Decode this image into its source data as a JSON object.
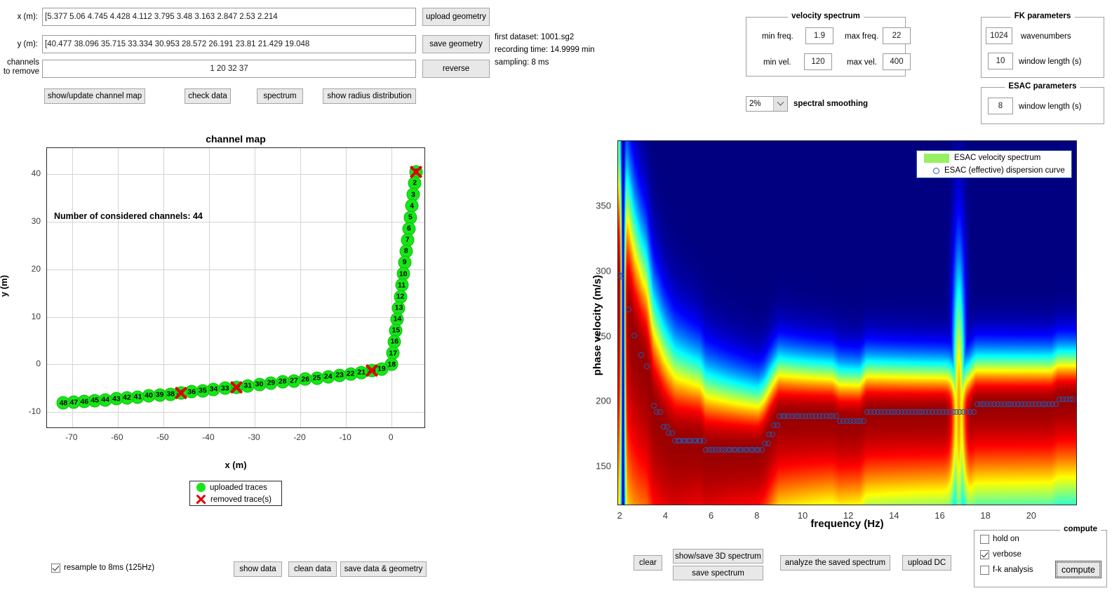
{
  "geometry": {
    "x_label": "x (m):",
    "x_value": "[5.377      5.06      4.745      4.428      4.112      3.795      3.48      3.163      2.847      2.53      2.214",
    "y_label": "y (m):",
    "y_value": "[40.477      38.096      35.715      33.334      30.953      28.572      26.191      23.81      21.429      19.048",
    "channels_label_line1": "channels",
    "channels_label_line2": "to remove",
    "channels_value": "1  20  32  37",
    "upload_geometry": "upload geometry",
    "save_geometry": "save geometry",
    "reverse": "reverse"
  },
  "dataset_info": {
    "first_dataset": "first dataset: 1001.sg2",
    "recording_time": "recording time: 14.9999 min",
    "sampling": "sampling: 8 ms"
  },
  "actions_row": {
    "show_update_channel_map": "show/update channel map",
    "check_data": "check data",
    "spectrum": "spectrum",
    "show_radius_distribution": "show radius distribution"
  },
  "velocity_spectrum": {
    "title": "velocity spectrum",
    "min_freq_label": "min freq.",
    "min_freq_value": "1.9",
    "max_freq_label": "max freq.",
    "max_freq_value": "22",
    "min_vel_label": "min vel.",
    "min_vel_value": "120",
    "max_vel_label": "max vel.",
    "max_vel_value": "400"
  },
  "smoothing": {
    "value": "2%",
    "label": "spectral smoothing",
    "options": [
      "2%"
    ]
  },
  "fk_parameters": {
    "title": "FK parameters",
    "wavenumbers_value": "1024",
    "wavenumbers_label": "wavenumbers",
    "window_length_value": "10",
    "window_length_label": "window length (s)"
  },
  "esac_parameters": {
    "title": "ESAC parameters",
    "window_length_value": "8",
    "window_length_label": "window length (s)"
  },
  "bottom_left": {
    "resample_label": "resample to 8ms (125Hz)",
    "resample_checked": true,
    "show_data": "show data",
    "clean_data": "clean data",
    "save_data_geometry": "save data & geometry"
  },
  "bottom_right": {
    "clear": "clear",
    "show_save_3d_spectrum": "show/save 3D spectrum",
    "save_spectrum": "save spectrum",
    "analyze_saved_spectrum": "analyze the saved spectrum",
    "upload_dc": "upload DC",
    "compute_panel_title": "compute",
    "hold_on_label": "hold on",
    "hold_on_checked": false,
    "verbose_label": "verbose",
    "verbose_checked": true,
    "fk_analysis_label": "f-k analysis",
    "fk_analysis_checked": false,
    "compute_button": "compute"
  },
  "colors": {
    "trace_green": "#16e616",
    "removed_red": "#e00000",
    "dispersion_blue": "#2a56a8",
    "legend_swatch_green": "#96f062",
    "button_face": "#e8e8e8"
  },
  "chart_data": [
    {
      "type": "scatter",
      "id": "channel-map",
      "title": "channel map",
      "xlabel": "x (m)",
      "ylabel": "y (m)",
      "xlim": [
        -75.5,
        7.5
      ],
      "ylim": [
        -13.5,
        45.5
      ],
      "xticks": [
        -70,
        -60,
        -50,
        -40,
        -30,
        -20,
        -10,
        0
      ],
      "yticks": [
        -10,
        0,
        10,
        20,
        30,
        40
      ],
      "grid": true,
      "annotation": "Number of considered channels: 44",
      "legend": [
        "uploaded traces",
        "removed trace(s)"
      ],
      "legend_position": "below-axes-center",
      "removed_channels": [
        1,
        20,
        32,
        37
      ],
      "points": [
        {
          "ch": 1,
          "x": 5.377,
          "y": 40.477
        },
        {
          "ch": 2,
          "x": 5.06,
          "y": 38.096
        },
        {
          "ch": 3,
          "x": 4.745,
          "y": 35.715
        },
        {
          "ch": 4,
          "x": 4.428,
          "y": 33.334
        },
        {
          "ch": 5,
          "x": 4.112,
          "y": 30.953
        },
        {
          "ch": 6,
          "x": 3.795,
          "y": 28.572
        },
        {
          "ch": 7,
          "x": 3.48,
          "y": 26.191
        },
        {
          "ch": 8,
          "x": 3.163,
          "y": 23.81
        },
        {
          "ch": 9,
          "x": 2.847,
          "y": 21.429
        },
        {
          "ch": 10,
          "x": 2.53,
          "y": 19.048
        },
        {
          "ch": 11,
          "x": 2.214,
          "y": 16.667
        },
        {
          "ch": 12,
          "x": 1.897,
          "y": 14.286
        },
        {
          "ch": 13,
          "x": 1.581,
          "y": 11.905
        },
        {
          "ch": 14,
          "x": 1.264,
          "y": 9.524
        },
        {
          "ch": 15,
          "x": 0.948,
          "y": 7.143
        },
        {
          "ch": 16,
          "x": 0.632,
          "y": 4.762
        },
        {
          "ch": 17,
          "x": 0.316,
          "y": 2.381
        },
        {
          "ch": 18,
          "x": 0.0,
          "y": 0.0
        },
        {
          "ch": 19,
          "x": -2.2,
          "y": -0.95
        },
        {
          "ch": 20,
          "x": -4.4,
          "y": -1.3
        },
        {
          "ch": 21,
          "x": -6.6,
          "y": -1.65
        },
        {
          "ch": 22,
          "x": -9.0,
          "y": -2.0
        },
        {
          "ch": 23,
          "x": -11.4,
          "y": -2.3
        },
        {
          "ch": 24,
          "x": -13.9,
          "y": -2.6
        },
        {
          "ch": 25,
          "x": -16.4,
          "y": -2.85
        },
        {
          "ch": 26,
          "x": -18.9,
          "y": -3.1
        },
        {
          "ch": 27,
          "x": -21.4,
          "y": -3.4
        },
        {
          "ch": 28,
          "x": -23.9,
          "y": -3.65
        },
        {
          "ch": 29,
          "x": -26.4,
          "y": -3.9
        },
        {
          "ch": 30,
          "x": -29.0,
          "y": -4.2
        },
        {
          "ch": 31,
          "x": -31.5,
          "y": -4.5
        },
        {
          "ch": 32,
          "x": -34.0,
          "y": -4.75
        },
        {
          "ch": 33,
          "x": -36.5,
          "y": -5.0
        },
        {
          "ch": 34,
          "x": -39.0,
          "y": -5.25
        },
        {
          "ch": 35,
          "x": -41.4,
          "y": -5.5
        },
        {
          "ch": 36,
          "x": -43.8,
          "y": -5.75
        },
        {
          "ch": 37,
          "x": -46.2,
          "y": -6.0
        },
        {
          "ch": 38,
          "x": -48.4,
          "y": -6.2
        },
        {
          "ch": 39,
          "x": -50.8,
          "y": -6.4
        },
        {
          "ch": 40,
          "x": -53.2,
          "y": -6.6
        },
        {
          "ch": 41,
          "x": -55.6,
          "y": -6.8
        },
        {
          "ch": 42,
          "x": -58.0,
          "y": -7.0
        },
        {
          "ch": 43,
          "x": -60.3,
          "y": -7.2
        },
        {
          "ch": 44,
          "x": -62.7,
          "y": -7.4
        },
        {
          "ch": 45,
          "x": -65.0,
          "y": -7.6
        },
        {
          "ch": 46,
          "x": -67.3,
          "y": -7.8
        },
        {
          "ch": 47,
          "x": -69.6,
          "y": -7.95
        },
        {
          "ch": 48,
          "x": -71.9,
          "y": -8.1
        }
      ]
    },
    {
      "type": "heatmap",
      "id": "velocity-spectrum",
      "title": "",
      "xlabel": "frequency (Hz)",
      "ylabel": "phase velocity (m/s)",
      "xlim": [
        1.9,
        22
      ],
      "ylim": [
        120,
        400
      ],
      "xticks": [
        2,
        4,
        6,
        8,
        10,
        12,
        14,
        16,
        18,
        20
      ],
      "yticks": [
        150,
        200,
        250,
        300,
        350
      ],
      "grid": false,
      "colormap": "jet",
      "legend": [
        "ESAC velocity spectrum",
        "ESAC (effective) dispersion curve"
      ],
      "legend_position": "top-right",
      "dispersion_curve": {
        "name": "ESAC (effective) dispersion curve",
        "x": [
          1.95,
          2.05,
          2.35,
          2.6,
          2.9,
          3.15,
          3.45,
          3.6,
          3.9,
          4.1,
          4.4,
          4.6,
          4.85,
          5.05,
          5.3,
          5.5,
          5.75,
          6.0,
          6.3,
          6.55,
          6.8,
          7.05,
          7.3,
          7.55,
          7.8,
          8.05,
          8.3,
          8.5,
          8.7,
          8.95,
          9.2,
          9.5,
          9.8,
          10.1,
          10.4,
          10.7,
          11.0,
          11.3,
          11.6,
          11.9,
          12.2,
          12.5,
          12.8,
          13.1,
          13.4,
          13.7,
          14.0,
          14.3,
          14.6,
          14.9,
          15.2,
          15.5,
          15.8,
          16.1,
          16.4,
          16.7,
          17.0,
          17.3,
          17.6,
          17.9,
          18.2,
          18.5,
          18.8,
          19.1,
          19.4,
          19.7,
          20.0,
          20.3,
          20.6,
          20.9,
          21.2,
          21.5,
          21.8
        ],
        "y": [
          297,
          296,
          271,
          251,
          236,
          227,
          197,
          192,
          181,
          176,
          170,
          170,
          170,
          170,
          170,
          170,
          163,
          163,
          163,
          163,
          163,
          163,
          163,
          163,
          163,
          163,
          168,
          175,
          182,
          189,
          189,
          189,
          189,
          189,
          189,
          189,
          189,
          189,
          185,
          185,
          185,
          185,
          192,
          192,
          192,
          192,
          192,
          192,
          192,
          192,
          192,
          192,
          192,
          192,
          192,
          192,
          192,
          192,
          198,
          198,
          198,
          198,
          198,
          198,
          198,
          198,
          198,
          198,
          198,
          198,
          202,
          202,
          202
        ]
      }
    }
  ]
}
